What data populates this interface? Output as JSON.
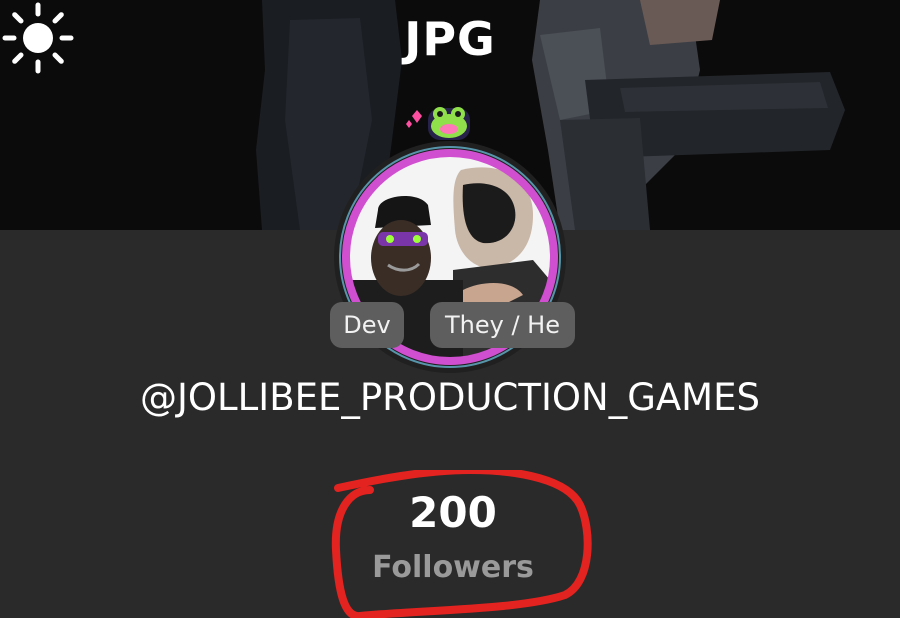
{
  "profile": {
    "display_name": "JPG",
    "username": "@JOLLIBEE_PRODUCTION_GAMES",
    "badges": {
      "role": "Dev",
      "pronouns": "They / He"
    },
    "stats": {
      "followers_count": "200",
      "followers_label": "Followers"
    }
  },
  "header": {
    "theme_icon": "sun-icon"
  },
  "colors": {
    "background": "#2a2a2a",
    "banner": "#0b0b0b",
    "badge_bg": "#5e5e5e",
    "annotation": "#e3231f",
    "avatar_ring": "#d04fd0"
  }
}
